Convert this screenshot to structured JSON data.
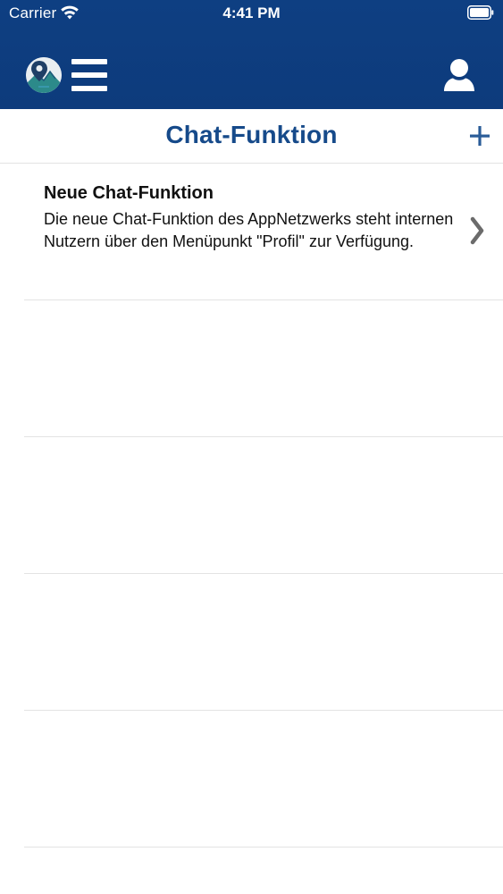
{
  "status_bar": {
    "carrier": "Carrier",
    "time": "4:41 PM"
  },
  "header": {
    "logo_icon": "map-pin-mountain-logo-icon",
    "menu_icon": "hamburger-menu-icon",
    "profile_icon": "user-profile-icon",
    "background_color": "#0e3f82"
  },
  "page": {
    "title": "Chat-Funktion",
    "title_color": "#164a8a",
    "add_icon": "plus-icon"
  },
  "list": {
    "items": [
      {
        "title": "Neue Chat-Funktion",
        "text": "Die neue Chat-Funktion des AppNetzwerks steht internen Nutzern über den Menüpunkt \"Profil\" zur Verfügung.",
        "icon": "chevron-right-icon"
      }
    ]
  }
}
